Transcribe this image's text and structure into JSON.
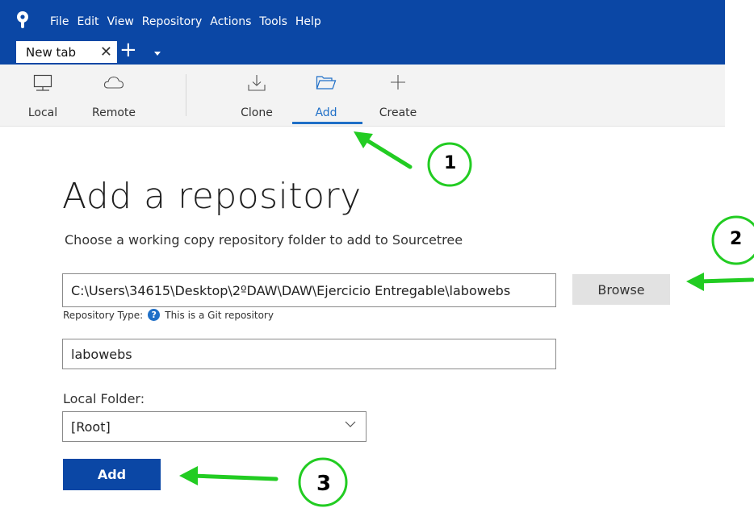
{
  "menu": [
    "File",
    "Edit",
    "View",
    "Repository",
    "Actions",
    "Tools",
    "Help"
  ],
  "tab": {
    "label": "New tab",
    "close_glyph": "✕",
    "add_glyph": "+"
  },
  "toolbar": {
    "local": "Local",
    "remote": "Remote",
    "clone": "Clone",
    "add": "Add",
    "create": "Create",
    "active": "Add"
  },
  "page": {
    "title": "Add a repository",
    "subtitle": "Choose a working copy repository folder to add to Sourcetree"
  },
  "path_field": {
    "value": "C:\\Users\\34615\\Desktop\\2ºDAW\\DAW\\Ejercicio Entregable\\labowebs"
  },
  "browse_button": "Browse",
  "repo_type": {
    "label": "Repository Type:",
    "help_glyph": "?",
    "value": "This is a Git repository"
  },
  "name_field": {
    "value": "labowebs"
  },
  "local_folder": {
    "label": "Local Folder:",
    "value": "[Root]"
  },
  "add_button": "Add",
  "annotations": {
    "numbers": [
      "1",
      "2",
      "3"
    ],
    "color": "#22cc22"
  },
  "colors": {
    "brand": "#0b47a5",
    "accent": "#1f6fc7",
    "annotation": "#22cc22"
  }
}
